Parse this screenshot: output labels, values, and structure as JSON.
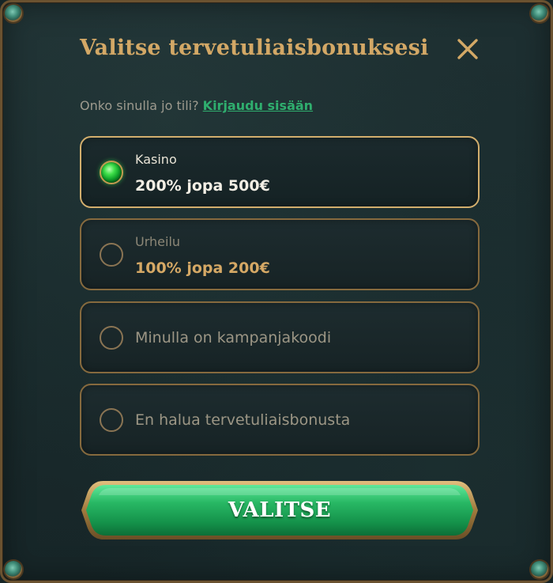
{
  "modal": {
    "title": "Valitse tervetuliaisbonuksesi",
    "close_icon": "close-icon"
  },
  "login": {
    "prompt": "Onko sinulla jo tili?",
    "link": "Kirjaudu sisään"
  },
  "options": [
    {
      "label": "Kasino",
      "value": "200% jopa 500€",
      "selected": true
    },
    {
      "label": "Urheilu",
      "value": "100% jopa 200€",
      "selected": false
    },
    {
      "label": "Minulla on kampanjakoodi",
      "selected": false
    },
    {
      "label": "En halua tervetuliaisbonusta",
      "selected": false
    }
  ],
  "cta": {
    "label": "VALITSE"
  },
  "colors": {
    "title_gold": "#d3a866",
    "link_green": "#2fae6e",
    "border_gold": "#866a3e",
    "button_green": "#22a85a"
  }
}
